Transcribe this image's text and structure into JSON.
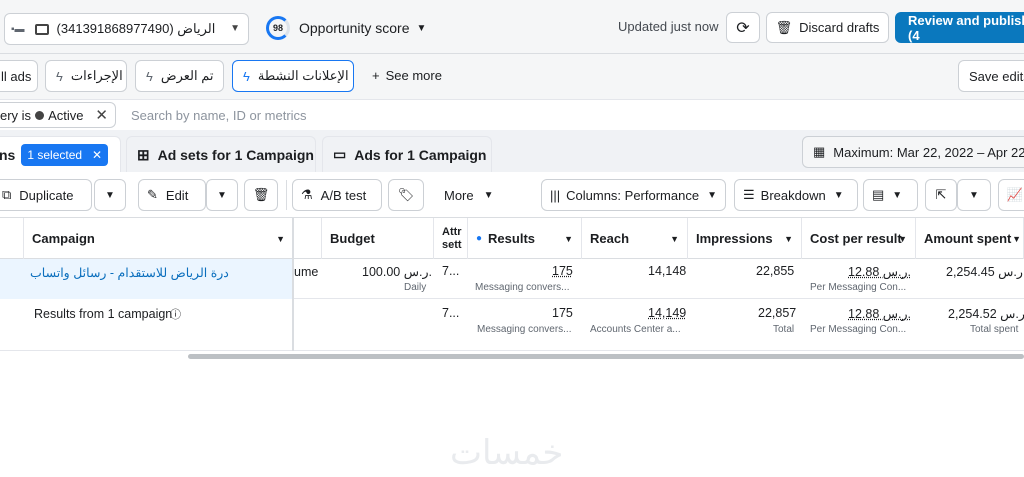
{
  "header": {
    "account_text": "الرياض (341391868977490)",
    "score_value": "98",
    "score_label": "Opportunity score",
    "updated": "Updated just now",
    "discard": "Discard drafts",
    "review": "Review and publish (4"
  },
  "views": {
    "all_ads": "ll ads",
    "procedures": "الإجراءات",
    "display": "تم العرض",
    "active_ads": "الإعلانات النشطة",
    "see_more": "See more",
    "save_edits": "Save edits"
  },
  "filter": {
    "chip_prefix": "ery is",
    "chip_value": "Active",
    "search_placeholder": "Search by name, ID or metrics"
  },
  "tabs": {
    "campaigns_partial": "ns",
    "selected": "1 selected",
    "adsets": "Ad sets for 1 Campaign",
    "ads": "Ads for 1 Campaign"
  },
  "date_range": "Maximum: Mar 22, 2022 – Apr 22, 2",
  "toolbar": {
    "duplicate": "Duplicate",
    "edit": "Edit",
    "ab_test": "A/B test",
    "more": "More",
    "columns": "Columns: Performance",
    "breakdown": "Breakdown"
  },
  "table": {
    "headers": {
      "campaign": "Campaign",
      "budget": "Budget",
      "attribution": "Attr sett",
      "results": "Results",
      "reach": "Reach",
      "impressions": "Impressions",
      "cost": "Cost per result",
      "amount": "Amount spent"
    },
    "row1": {
      "campaign": "درة الرياض للاستقدام - رسائل واتساب",
      "extra": "ume",
      "budget": "100.00 ر.س.",
      "budget_sub": "Daily",
      "attribution": "7...",
      "results": "175",
      "results_sub": "Messaging convers...",
      "reach": "14,148",
      "impressions": "22,855",
      "cost": "12.88 ر.س.",
      "cost_sub": "Per Messaging Con...",
      "amount": "2,254.45 ر.س."
    },
    "row2": {
      "campaign": "Results from 1 campaign",
      "attribution": "7...",
      "results": "175",
      "results_sub": "Messaging convers...",
      "reach": "14,149",
      "reach_sub": "Accounts Center a...",
      "impressions": "22,857",
      "impressions_sub": "Total",
      "cost": "12.88 ر.س.",
      "cost_sub": "Per Messaging Con...",
      "amount": "2,254.52 ر.س.",
      "amount_sub": "Total spent"
    }
  },
  "watermark": "خمسات",
  "colors": {
    "accent": "#1877f2",
    "primary_button": "#0a78be",
    "link": "#0a6ebd"
  }
}
